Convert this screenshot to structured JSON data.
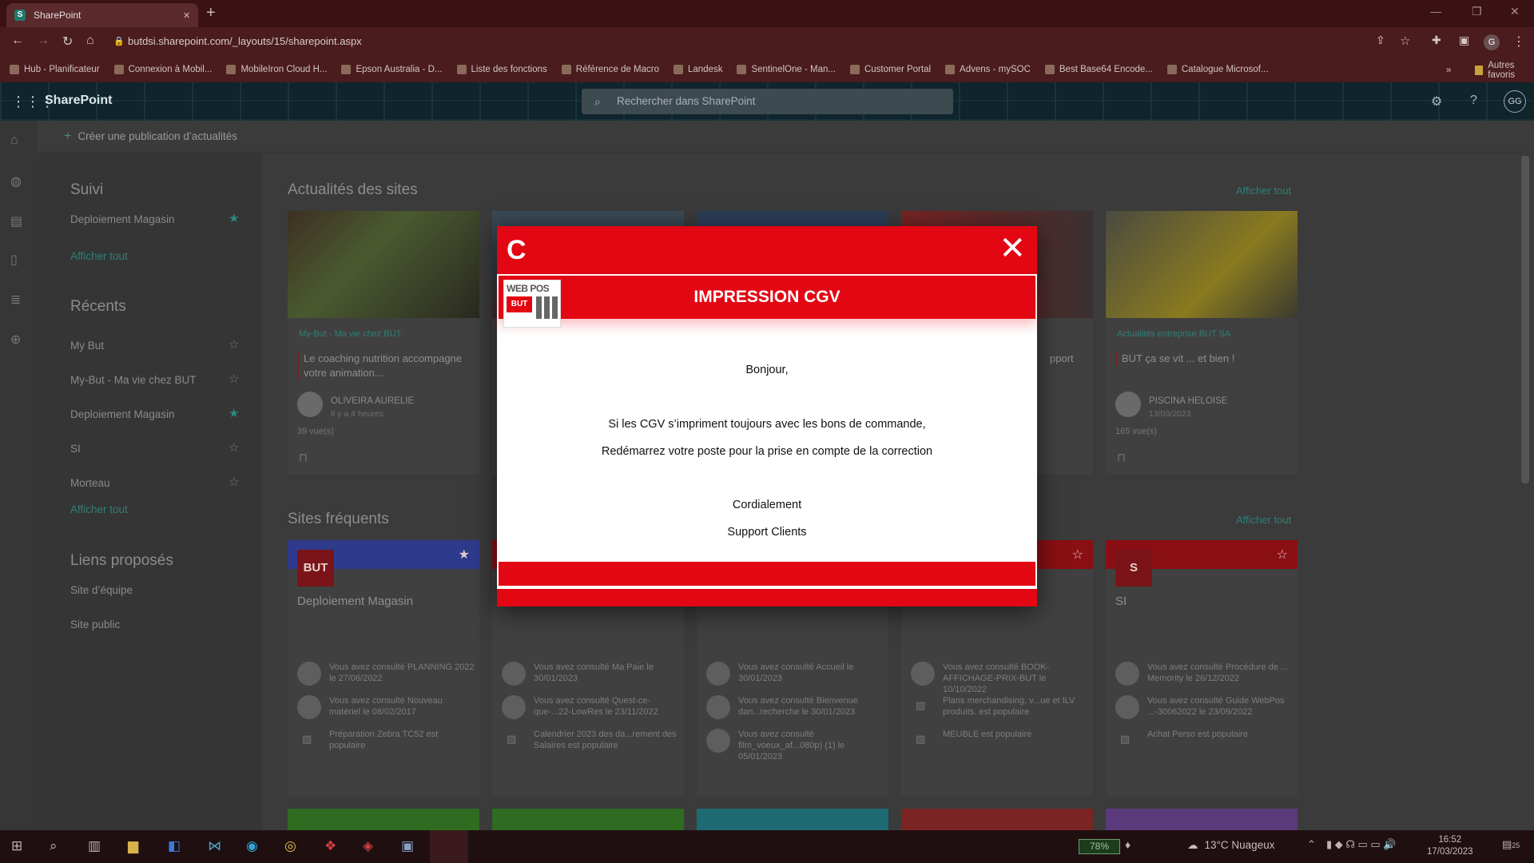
{
  "browser": {
    "tab_title": "SharePoint",
    "url": "butdsi.sharepoint.com/_layouts/15/sharepoint.aspx",
    "bookmarks": [
      "Hub - Planificateur",
      "Connexion à Mobil...",
      "MobileIron Cloud H...",
      "Epson Australia - D...",
      "Liste des fonctions",
      "Référence de Macro",
      "Landesk",
      "SentinelOne - Man...",
      "Customer Portal",
      "Advens - mySOC",
      "Best Base64 Encode...",
      "Catalogue Microsof..."
    ],
    "other_bookmarks": "Autres favoris",
    "profile_initial": "G"
  },
  "suitebar": {
    "app_name": "SharePoint",
    "search_placeholder": "Rechercher dans SharePoint",
    "avatar_initials": "GG"
  },
  "commandbar": {
    "create_news": "Créer une publication d’actualités"
  },
  "sidepanel": {
    "followed_title": "Suivi",
    "followed": [
      {
        "label": "Deploiement Magasin",
        "starred": true
      }
    ],
    "followed_show_all": "Afficher tout",
    "recent_title": "Récents",
    "recent": [
      {
        "label": "My But",
        "starred": false
      },
      {
        "label": "My-But - Ma vie chez BUT",
        "starred": false
      },
      {
        "label": "Deploiement Magasin",
        "starred": true
      },
      {
        "label": "SI",
        "starred": false
      },
      {
        "label": "Morteau",
        "starred": false
      }
    ],
    "recent_show_all": "Afficher tout",
    "links_title": "Liens proposés",
    "links": [
      "Site d’équipe",
      "Site public"
    ]
  },
  "news": {
    "title": "Actualités des sites",
    "show_all": "Afficher tout",
    "cards": [
      {
        "category": "My-But - Ma vie chez BUT",
        "title": "Le coaching nutrition accompagne votre animation...",
        "author": "OLIVEIRA AURELIE",
        "when": "Il y a 4 heures",
        "views": "39 vue(s)"
      },
      {
        "category": "",
        "title": "",
        "author": "",
        "when": "",
        "views": ""
      },
      {
        "category": "",
        "title": "",
        "author": "",
        "when": "",
        "views": ""
      },
      {
        "category": "",
        "title": "pport",
        "author": "",
        "when": "",
        "views": ""
      },
      {
        "category": "Actualités entreprise BUT SA",
        "title": "BUT ça se vit ... et bien !",
        "author": "PISCINA HELOISE",
        "when": "13/03/2023",
        "views": "165 vue(s)"
      }
    ]
  },
  "frequent": {
    "title": "Sites fréquents",
    "show_all": "Afficher tout",
    "sites": [
      {
        "logo": "BUT",
        "name": "Deploiement Magasin",
        "band_color": "#2e3a8c",
        "activities": [
          "Vous avez consulté PLANNING 2022 le 27/06/2022",
          "Vous avez consulté Nouveau matériel le 08/02/2017",
          "Préparation Zebra TC52 est populaire"
        ]
      },
      {
        "logo": "",
        "name": "",
        "band_color": "#8a0f14",
        "activities": [
          "Vous avez consulté Ma Paie le 30/01/2023",
          "Vous avez consulté Quest-ce-que-...22-LowRes le 23/11/2022",
          "Calendrier 2023 des da...rement des Salaires est populaire"
        ]
      },
      {
        "logo": "",
        "name": "",
        "band_color": "#8a0f14",
        "activities": [
          "Vous avez consulté Accueil le 30/01/2023",
          "Vous avez consulté Bienvenue dan...recherche le 30/01/2023",
          "Vous avez consulté film_voeux_af...080p) (1) le 05/01/2023"
        ]
      },
      {
        "logo": "",
        "name": "",
        "band_color": "#8a0f14",
        "activities": [
          "Vous avez consulté BOOK-AFFICHAGE-PRIX-BUT le 10/10/2022",
          "Plans merchandising, v...ue et ILV produits. est populaire",
          "MEUBLE est populaire"
        ]
      },
      {
        "logo": "S",
        "name": "SI",
        "band_color": "#8a0f14",
        "activities": [
          "Vous avez consulté Procédure de ... Memority le 26/12/2022",
          "Vous avez consulté Guide WebPos ...-30062022 le 23/09/2022",
          "Achat Perso est populaire"
        ]
      }
    ]
  },
  "modal": {
    "logo_glyph": "C",
    "close_glyph": "✕",
    "banner_logo_top": "WEB POS",
    "banner_logo_brand": "BUT",
    "title": "IMPRESSION CGV",
    "greeting": "Bonjour,",
    "line1": "Si les CGV s’impriment toujours avec les bons de commande,",
    "line2": "Redémarrez votre poste pour la prise en compte de la correction",
    "closing": "Cordialement",
    "signature": "Support Clients",
    "accent_color": "#e30613"
  },
  "taskbar": {
    "battery": "78%",
    "weather": "13°C  Nuageux",
    "time": "16:52",
    "date": "17/03/2023",
    "notifications": "25"
  }
}
